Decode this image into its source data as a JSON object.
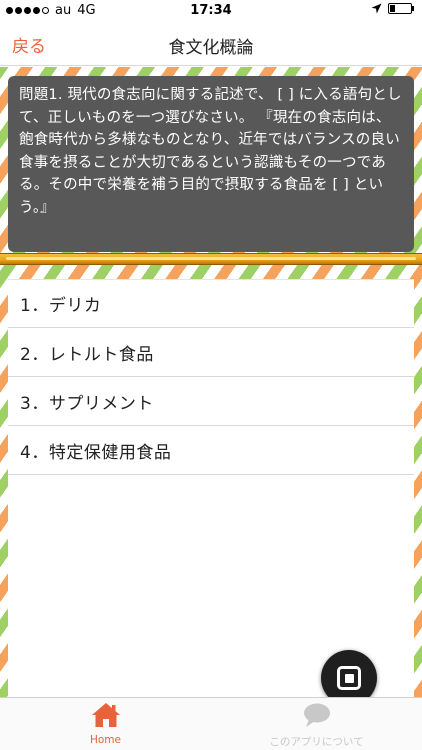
{
  "status_bar": {
    "carrier": "au",
    "network": "4G",
    "time": "17:34"
  },
  "nav": {
    "back_label": "戻る",
    "title": "食文化概論"
  },
  "question": {
    "text": "問題1. 現代の食志向に関する記述で、 [ ] に入る語句として、正しいものを一つ選びなさい。 『現在の食志向は、飽食時代から多様なものとなり、近年ではバランスの良い食事を摂ることが大切であるという認識もその一つである。その中で栄養を補う目的で摂取する食品を [ ] という。』"
  },
  "answers": [
    {
      "label": "1．デリカ"
    },
    {
      "label": "2．レトルト食品"
    },
    {
      "label": "3．サプリメント"
    },
    {
      "label": "4．特定保健用食品"
    }
  ],
  "tabs": [
    {
      "label": "Home",
      "icon": "home-icon"
    },
    {
      "label": "このアプリについて",
      "icon": "speech-bubble-icon"
    }
  ],
  "colors": {
    "accent": "#e8623a",
    "question_bg": "#585858",
    "progress": "#e8a51c",
    "stripe_orange": "#f5a25d",
    "stripe_green": "#9fd064"
  }
}
